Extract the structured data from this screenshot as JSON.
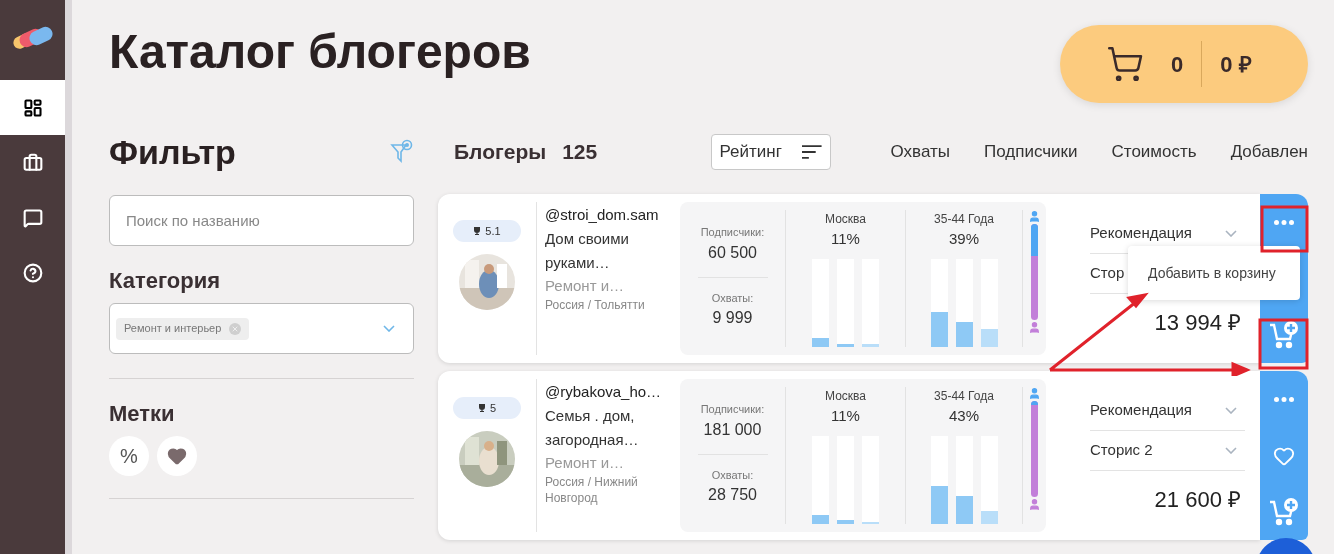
{
  "sidebar": {
    "items": [
      {
        "kind": "dashboard",
        "selected": true
      },
      {
        "kind": "briefcase",
        "selected": false
      },
      {
        "kind": "chat",
        "selected": false
      },
      {
        "kind": "help",
        "selected": false
      }
    ]
  },
  "title": "Каталог блогеров",
  "cart": {
    "count": "0",
    "total": "0 ₽"
  },
  "filter": {
    "title": "Фильтр",
    "search": {
      "placeholder": "Поиск по названию"
    },
    "category": {
      "label": "Категория",
      "chips": [
        "Ремонт и интерьер"
      ]
    },
    "tags": {
      "label": "Метки",
      "items": [
        {
          "kind": "percent",
          "label": "%"
        },
        {
          "kind": "heart"
        }
      ]
    }
  },
  "list": {
    "title": "Блогеры",
    "count": "125",
    "sort": [
      {
        "label": "Рейтинг",
        "selected": true
      },
      {
        "label": "Охваты",
        "selected": false
      },
      {
        "label": "Подписчики",
        "selected": false
      },
      {
        "label": "Стоимость",
        "selected": false
      },
      {
        "label": "Добавлен",
        "selected": false
      }
    ]
  },
  "cards": [
    {
      "rating": "5.1",
      "handle": "@stroi_dom.sam",
      "description": "Дом своими руками…",
      "category": "Ремонт и…",
      "location": "Россия / Тольятти",
      "followers_label": "Подписчики:",
      "followers": "60 500",
      "reach_label": "Охваты:",
      "reach": "9 999",
      "city": {
        "label": "Москва",
        "percent": "11%",
        "bars": [
          {
            "level": 0.1
          },
          {
            "level": 0.03
          },
          {
            "level": 0.03
          }
        ]
      },
      "age": {
        "label": "35-44 Года",
        "percent": "39%",
        "bars": [
          {
            "level": 0.39
          },
          {
            "level": 0.28
          },
          {
            "level": 0.2
          }
        ]
      },
      "gender": {
        "level": 0.33
      },
      "selects": [
        {
          "label": "Рекомендация",
          "chevron": true
        },
        {
          "label": "Стор"
        }
      ],
      "price": "13 994 ₽",
      "actions": [
        {
          "kind": "more"
        },
        {
          "kind": "cart"
        }
      ],
      "popup": {
        "label": "Добавить в корзину"
      }
    },
    {
      "rating": "5",
      "handle": "@rybakova_ho…",
      "description": "Семья . дом, загородная…",
      "category": "Ремонт и…",
      "location": "Россия / Нижний Новгород",
      "followers_label": "Подписчики:",
      "followers": "181 000",
      "reach_label": "Охваты:",
      "reach": "28 750",
      "city": {
        "label": "Москва",
        "percent": "11%",
        "bars": [
          {
            "level": 0.1
          },
          {
            "level": 0.04
          },
          {
            "level": 0.02
          }
        ]
      },
      "age": {
        "label": "35-44 Года",
        "percent": "43%",
        "bars": [
          {
            "level": 0.43
          },
          {
            "level": 0.31
          },
          {
            "level": 0.14
          }
        ]
      },
      "gender": {
        "level": 0.04
      },
      "selects": [
        {
          "label": "Рекомендация",
          "chevron": true
        },
        {
          "label": "Сторис 2",
          "chevron": true
        }
      ],
      "price": "21 600 ₽",
      "actions": [
        {
          "kind": "more"
        },
        {
          "kind": "heart"
        },
        {
          "kind": "cart"
        }
      ]
    }
  ]
}
